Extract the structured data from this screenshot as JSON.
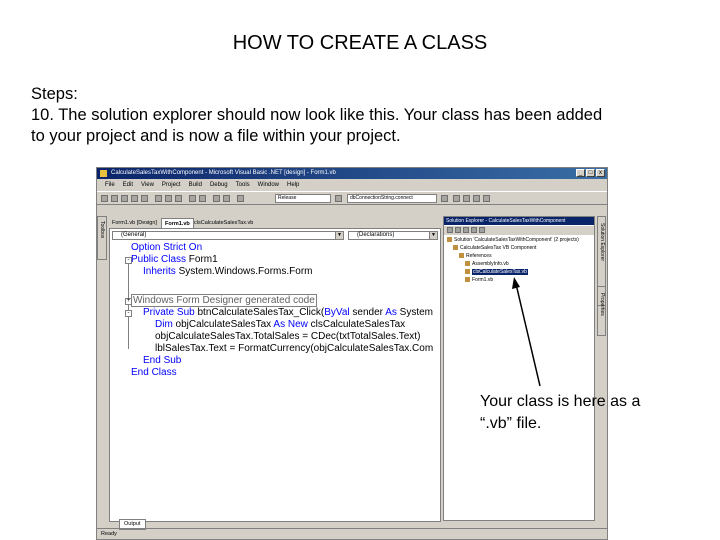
{
  "slide": {
    "title": "HOW TO CREATE A CLASS",
    "steps_heading": "Steps:",
    "step_line_1": "10. The solution explorer should now look like this.  Your class has been added",
    "step_line_2": "to your project and is now a file within your project.",
    "callout_line_1": "Your class is here as a",
    "callout_line_2": "“.vb” file."
  },
  "window": {
    "title": "CalculateSalesTaxWithComponent - Microsoft Visual Basic .NET [design] - Form1.vb",
    "menu": [
      "File",
      "Edit",
      "View",
      "Project",
      "Build",
      "Debug",
      "Tools",
      "Window",
      "Help"
    ],
    "config_combo": "Release",
    "find_combo": "dbConnectionString.connect"
  },
  "toolbox_label": "Toolbox",
  "doc_tabs": [
    "Form1.vb [Design]",
    "Form1.vb",
    "clsCalculateSalesTax.vb"
  ],
  "editor": {
    "class_combo": "(General)",
    "method_combo": "(Declarations)",
    "lines": {
      "l1_kw": "Option Strict On",
      "l2_kw": "Public Class",
      "l2_txt": " Form1",
      "l3_kw": "Inherits",
      "l3_txt": " System.Windows.Forms.Form",
      "l4_region": "Windows Form Designer generated code",
      "l5_kw": "Private Sub",
      "l5_txt": " btnCalculateSalesTax_Click(",
      "l5_kw2": "ByVal",
      "l5_txt2": " sender ",
      "l5_kw3": "As",
      "l5_txt3": " System",
      "l6_kw": "Dim",
      "l6_txt": " objCalculateSalesTax ",
      "l6_kw2": "As New",
      "l6_txt2": " clsCalculateSalesTax",
      "l7_txt": "objCalculateSalesTax.TotalSales = CDec(txtTotalSales.Text)",
      "l8_txt": "lblSalesTax.Text = FormatCurrency(objCalculateSalesTax.Com",
      "l9_kw": "End Sub",
      "l10_kw": "End Class"
    }
  },
  "solution_explorer": {
    "title": "Solution Explorer - CalculateSalesTaxWithComponent",
    "solution": "Solution 'CalculateSalesTaxWithComponent' (2 projects)",
    "project1": "CalculateSalesTax VB Component",
    "references": "References",
    "assemblyinfo": "AssemblyInfo.vb",
    "class_file": "clsCalculateSalesTax.vb",
    "form_file": "Form1.vb"
  },
  "right_strip_1": "Solution Explorer",
  "right_strip_2": "Properties",
  "output_tab": "Output",
  "status": "Ready"
}
